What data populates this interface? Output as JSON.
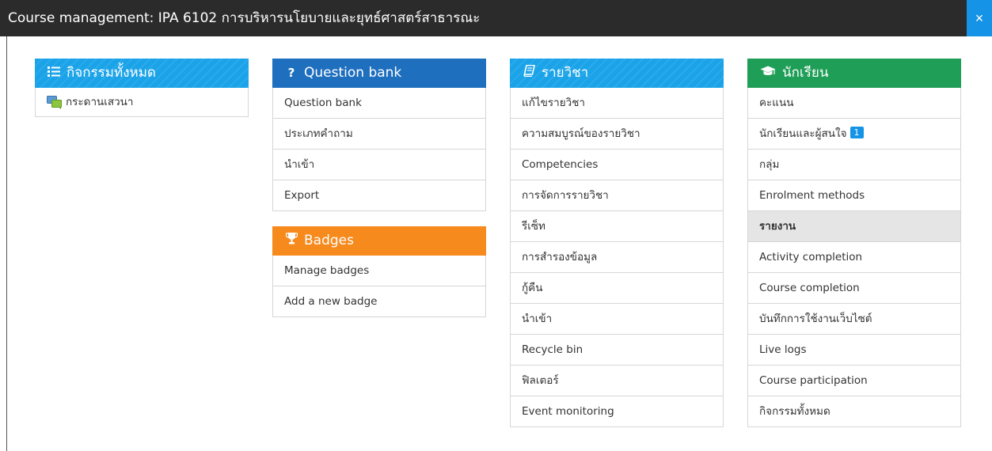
{
  "header": {
    "title": "Course management: IPA 6102 การบริหารนโยบายและยุทธ์ศาสตร์สาธารณะ",
    "close_label": "×"
  },
  "panels": {
    "activities": {
      "title": "กิจกรรมทั้งหมด",
      "icon": "list-icon",
      "items": [
        {
          "label": "กระดานเสวนา",
          "icon": "forum-icon"
        }
      ]
    },
    "question_bank": {
      "title": "Question bank",
      "icon": "question-icon",
      "items": [
        {
          "label": "Question bank"
        },
        {
          "label": "ประเภทคำถาม"
        },
        {
          "label": "นำเข้า"
        },
        {
          "label": "Export"
        }
      ]
    },
    "badges": {
      "title": "Badges",
      "icon": "trophy-icon",
      "items": [
        {
          "label": "Manage badges"
        },
        {
          "label": "Add a new badge"
        }
      ]
    },
    "course": {
      "title": "รายวิชา",
      "icon": "book-icon",
      "items": [
        {
          "label": "แก้ไขรายวิชา"
        },
        {
          "label": "ความสมบูรณ์ของรายวิชา"
        },
        {
          "label": "Competencies"
        },
        {
          "label": "การจัดการรายวิชา"
        },
        {
          "label": "รีเซ็ท"
        },
        {
          "label": "การสำรองข้อมูล"
        },
        {
          "label": "กู้คืน"
        },
        {
          "label": "นำเข้า"
        },
        {
          "label": "Recycle bin"
        },
        {
          "label": "ฟิลเตอร์"
        },
        {
          "label": "Event monitoring"
        }
      ]
    },
    "students": {
      "title": "นักเรียน",
      "icon": "graduation-cap-icon",
      "items": [
        {
          "label": "คะแนน"
        },
        {
          "label": "นักเรียนและผู้สนใจ",
          "badge": "1"
        },
        {
          "label": "กลุ่ม"
        },
        {
          "label": "Enrolment methods"
        },
        {
          "label": "รายงาน",
          "active": true
        },
        {
          "label": "Activity completion"
        },
        {
          "label": "Course completion"
        },
        {
          "label": "บันทึกการใช้งานเว็บไซต์"
        },
        {
          "label": "Live logs"
        },
        {
          "label": "Course participation"
        },
        {
          "label": "กิจกรรมทั้งหมด"
        }
      ]
    }
  },
  "colors": {
    "topbar": "#2b2b2b",
    "close": "#1593e6",
    "blue_header": "#1aa3e8",
    "dark_blue_header": "#1f6fbf",
    "orange_header": "#f68a1d",
    "green_header": "#1f9e57"
  }
}
